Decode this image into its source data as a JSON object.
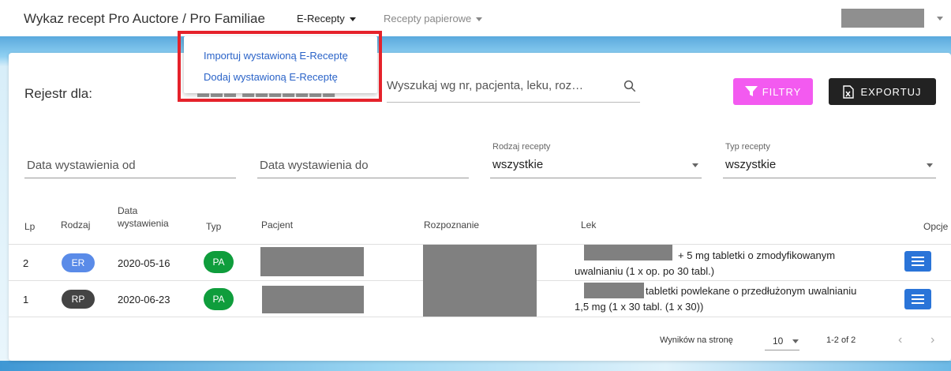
{
  "header": {
    "app_title": "Wykaz recept Pro Auctore / Pro Familiae",
    "menu_erecepty": "E-Recepty",
    "menu_papierowe": "Recepty papierowe"
  },
  "dropdown": {
    "items": [
      "Importuj wystawioną E-Receptę",
      "Dodaj wystawioną E-Receptę"
    ]
  },
  "register": {
    "label": "Rejestr dla:"
  },
  "search": {
    "placeholder": "Wyszukaj wg nr, pacjenta, leku, roz…"
  },
  "toolbar": {
    "filter_label": "FILTRY",
    "export_label": "EXPORTUJ"
  },
  "filters": {
    "date_from_placeholder": "Data wystawienia od",
    "date_to_placeholder": "Data wystawienia do",
    "rodzaj_label": "Rodzaj recepty",
    "rodzaj_value": "wszystkie",
    "typ_label": "Typ recepty",
    "typ_value": "wszystkie"
  },
  "table": {
    "headers": {
      "lp": "Lp",
      "rodzaj": "Rodzaj",
      "data_line1": "Data",
      "data_line2": "wystawienia",
      "typ": "Typ",
      "pacjent": "Pacjent",
      "rozpoznanie": "Rozpoznanie",
      "lek": "Lek",
      "opcje": "Opcje"
    },
    "rows": [
      {
        "lp": "2",
        "rodzaj": "ER",
        "rodzaj_color": "#5a8be8",
        "data": "2020-05-16",
        "typ": "PA",
        "typ_color": "#0f9d3c",
        "lek_line1": "+ 5 mg tabletki o zmodyfikowanym",
        "lek_line2": "uwalnianiu (1 x op. po 30 tabl.)"
      },
      {
        "lp": "1",
        "rodzaj": "RP",
        "rodzaj_color": "#444444",
        "data": "2020-06-23",
        "typ": "PA",
        "typ_color": "#0f9d3c",
        "lek_line1": "tabletki powlekane o przedłużonym uwalnianiu",
        "lek_line2": "1,5 mg (1 x 30 tabl. (1 x 30))"
      }
    ]
  },
  "pagination": {
    "per_page_label": "Wyników na stronę",
    "per_page_value": "10",
    "range": "1-2 of 2"
  },
  "colors": {
    "filter_button": "#f35af0",
    "export_button": "#222222",
    "options_button": "#2a74d8",
    "highlight_border": "#e5222b",
    "link": "#2a63c8"
  }
}
